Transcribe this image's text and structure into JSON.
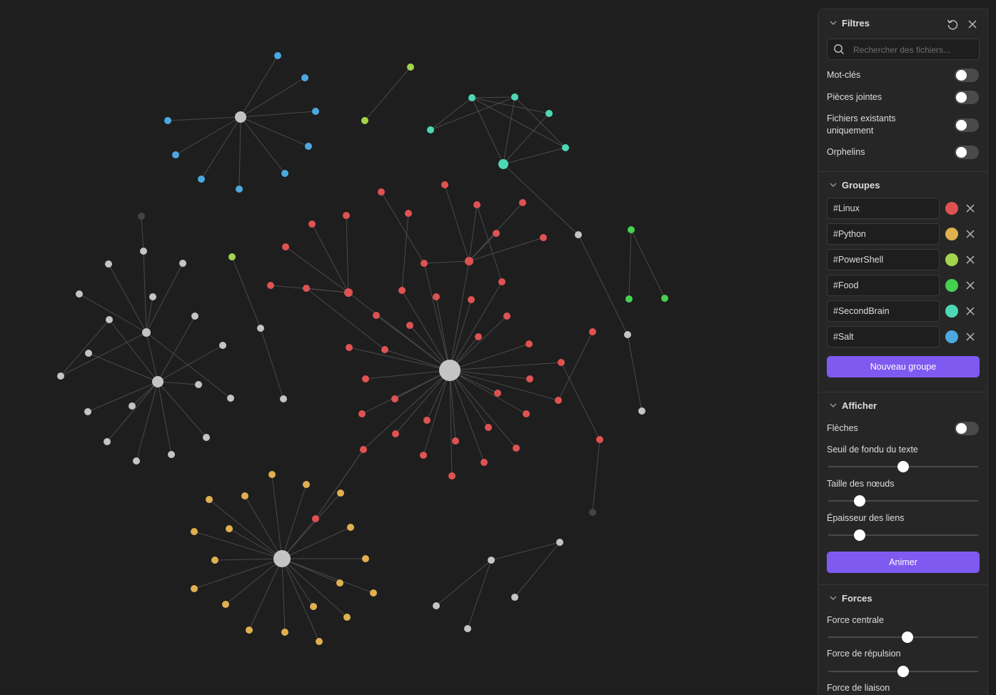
{
  "colors": {
    "linux": "#e05252",
    "python": "#e0b050",
    "powershell": "#a3d44c",
    "food": "#46d050",
    "secondbrain": "#4dd8b4",
    "salt": "#4ba9e0",
    "plain": "#c4c4c4",
    "dim": "#444444",
    "accent": "#7f5af0"
  },
  "filters": {
    "title": "Filtres",
    "reset_icon": "reset-icon",
    "close_icon": "close-icon",
    "search_placeholder": "Rechercher des fichiers...",
    "toggles": [
      {
        "label": "Mot-clés",
        "on": false
      },
      {
        "label": "Pièces jointes",
        "on": false
      },
      {
        "label": "Fichiers existants uniquement",
        "on": false
      },
      {
        "label": "Orphelins",
        "on": false
      }
    ]
  },
  "groups": {
    "title": "Groupes",
    "items": [
      {
        "query": "#Linux",
        "color": "#e05252"
      },
      {
        "query": "#Python",
        "color": "#e0b050"
      },
      {
        "query": "#PowerShell",
        "color": "#a3d44c"
      },
      {
        "query": "#Food",
        "color": "#46d050"
      },
      {
        "query": "#SecondBrain",
        "color": "#4dd8b4"
      },
      {
        "query": "#Salt",
        "color": "#4ba9e0"
      }
    ],
    "new_group_label": "Nouveau groupe"
  },
  "display": {
    "title": "Afficher",
    "arrows_label": "Flèches",
    "arrows_on": false,
    "sliders": [
      {
        "label": "Seuil de fondu du texte",
        "value": 0.5
      },
      {
        "label": "Taille des nœuds",
        "value": 0.21
      },
      {
        "label": "Épaisseur des liens",
        "value": 0.21
      }
    ],
    "animate_label": "Animer"
  },
  "forces": {
    "title": "Forces",
    "sliders": [
      {
        "label": "Force centrale",
        "value": 0.53
      },
      {
        "label": "Force de répulsion",
        "value": 0.5
      },
      {
        "label": "Force de liaison",
        "value": 0.5
      }
    ]
  }
}
